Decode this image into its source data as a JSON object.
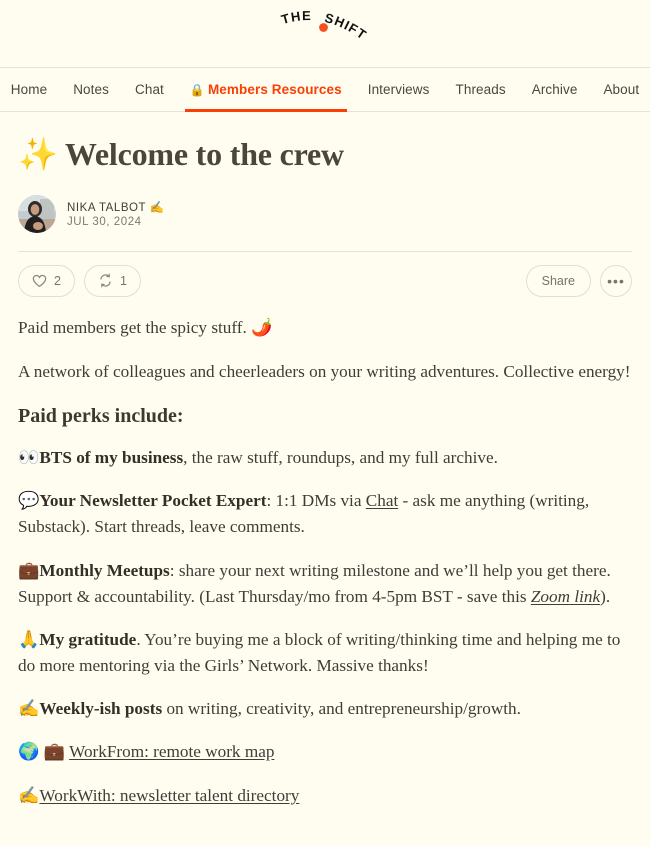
{
  "site": {
    "logo_text_1": "THE",
    "logo_text_2": "SHIFT",
    "logo_dot_color": "#f4511e",
    "accent_color": "#fa3e06",
    "background_color": "#fffdf0"
  },
  "nav": {
    "items": [
      {
        "label": "Home",
        "active": false,
        "icon": ""
      },
      {
        "label": "Notes",
        "active": false,
        "icon": ""
      },
      {
        "label": "Chat",
        "active": false,
        "icon": ""
      },
      {
        "label": "Members Resources",
        "active": true,
        "icon": "lock-icon",
        "icon_glyph": "🔒"
      },
      {
        "label": "Interviews",
        "active": false,
        "icon": ""
      },
      {
        "label": "Threads",
        "active": false,
        "icon": ""
      },
      {
        "label": "Archive",
        "active": false,
        "icon": ""
      },
      {
        "label": "About",
        "active": false,
        "icon": ""
      }
    ]
  },
  "post": {
    "title_emoji": "✨",
    "title": "Welcome to the crew",
    "author": "NIKA TALBOT",
    "author_emoji": "✍️",
    "date": "JUL 30, 2024"
  },
  "actions": {
    "like_count": "2",
    "restack_count": "1",
    "share_label": "Share",
    "more_label": "•••"
  },
  "content": {
    "intro_1": "Paid members get the spicy stuff.",
    "intro_1_emoji": "🌶️",
    "intro_2": "A network of colleagues and cheerleaders on your writing adventures. Collective energy!",
    "perks_heading": "Paid perks include:",
    "perk_1": {
      "emoji": "👀",
      "bold": "BTS of my business",
      "rest": ", the raw stuff, roundups, and my full archive."
    },
    "perk_2": {
      "emoji": "💬",
      "bold": "Your Newsletter Pocket Expert",
      "mid": ": 1:1 DMs via ",
      "link": "Chat",
      "rest": " - ask me anything (writing, Substack). Start threads, leave comments."
    },
    "perk_3": {
      "emoji": "💼",
      "bold": "Monthly Meetups",
      "mid": ": share your next writing milestone and we’ll help you get there. Support & accountability. (Last Thursday/mo from 4-5pm BST - save this ",
      "link": "Zoom link",
      "rest": ")."
    },
    "perk_4": {
      "emoji": "🙏",
      "bold": "My gratitude",
      "rest": ". You’re buying me a block of writing/thinking time and helping me to do more mentoring via the Girls’ Network. Massive thanks!"
    },
    "perk_5": {
      "emoji": "✍️",
      "bold": "Weekly-ish posts",
      "rest": " on writing, creativity, and entrepreneurship/growth."
    },
    "link_1": {
      "emoji_1": "🌍",
      "emoji_2": "💼",
      "label": "WorkFrom: remote work map"
    },
    "link_2": {
      "emoji_1": "✍️",
      "label": "WorkWith: newsletter talent directory"
    }
  }
}
